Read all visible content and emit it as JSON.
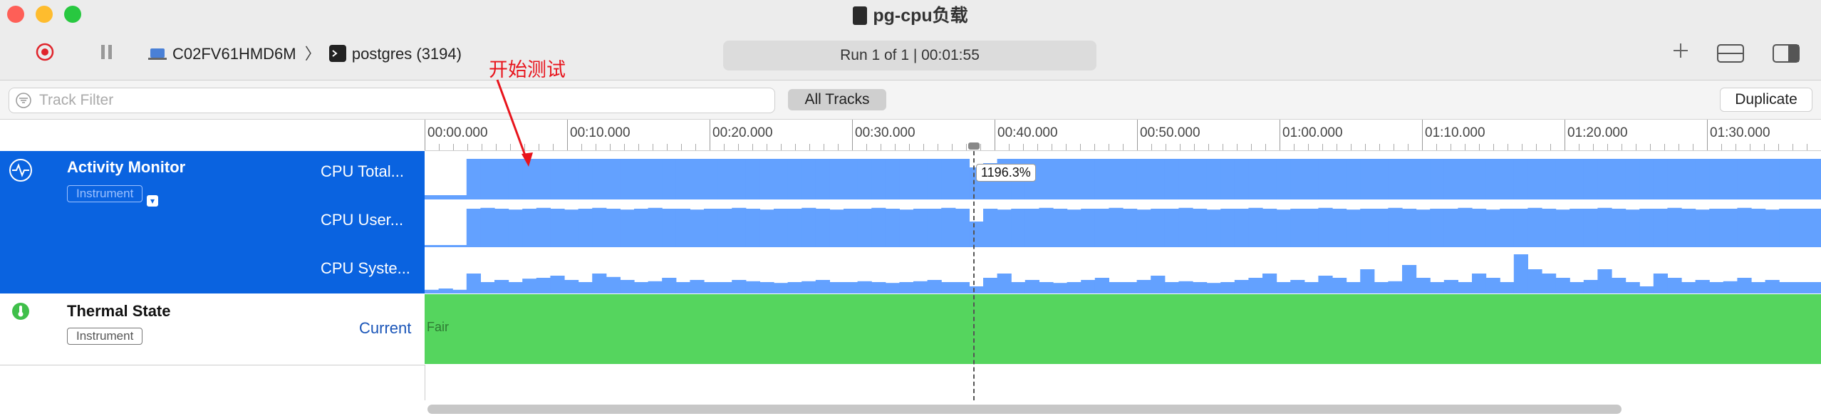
{
  "window": {
    "title": "pg-cpu负载",
    "target_device": "C02FV61HMD6M",
    "target_process": "postgres (3194)",
    "run_status": "Run 1 of 1  |  00:01:55"
  },
  "filterbar": {
    "placeholder": "Track Filter",
    "all_tracks_label": "All Tracks",
    "duplicate_label": "Duplicate"
  },
  "ruler": {
    "labels": [
      "00:00.000",
      "00:10.000",
      "00:20.000",
      "00:30.000",
      "00:40.000",
      "00:50.000",
      "01:00.000",
      "01:10.000",
      "01:20.000",
      "01:30.000"
    ]
  },
  "annotation": {
    "text": "开始测试",
    "color": "#e8141c"
  },
  "tracks": {
    "activity": {
      "name": "Activity Monitor",
      "badge": "Instrument",
      "series": [
        "CPU Total...",
        "CPU User...",
        "CPU Syste..."
      ],
      "tooltip": "1196.3%"
    },
    "thermal": {
      "name": "Thermal State",
      "badge": "Instrument",
      "series_label": "Current",
      "state": "Fair"
    }
  },
  "colors": {
    "selection": "#0a63e0",
    "graph_fill": "#63a1ff",
    "thermal_fair": "#55d55e",
    "record": "#e0242b"
  },
  "chart_data": {
    "type": "area",
    "series": [
      {
        "name": "CPU Total...",
        "values": [
          0.1,
          0.1,
          0.1,
          0.95,
          0.95,
          0.95,
          0.95,
          0.95,
          0.95,
          0.95,
          0.95,
          0.95,
          0.95,
          0.95,
          0.95,
          0.95,
          0.95,
          0.95,
          0.95,
          0.95,
          0.95,
          0.95,
          0.95,
          0.95,
          0.95,
          0.95,
          0.95,
          0.95,
          0.95,
          0.95,
          0.95,
          0.95,
          0.95,
          0.95,
          0.95,
          0.95,
          0.95,
          0.95,
          0.95,
          0.75,
          0.85,
          0.95,
          0.95,
          0.95,
          0.95,
          0.95,
          0.95,
          0.95,
          0.95,
          0.95,
          0.95,
          0.95,
          0.95,
          0.95,
          0.95,
          0.95,
          0.95,
          0.95,
          0.95,
          0.95,
          0.95,
          0.95,
          0.95,
          0.95,
          0.95,
          0.95,
          0.95,
          0.95,
          0.95,
          0.95,
          0.95,
          0.95,
          0.95,
          0.95,
          0.95,
          0.95,
          0.95,
          0.95,
          0.95,
          0.95,
          0.95,
          0.95,
          0.95,
          0.95,
          0.95,
          0.95,
          0.95,
          0.95,
          0.95,
          0.95,
          0.95,
          0.95,
          0.95,
          0.95,
          0.95,
          0.95,
          0.95,
          0.95,
          0.95,
          0.95
        ]
      },
      {
        "name": "CPU User...",
        "values": [
          0.05,
          0.05,
          0.05,
          0.9,
          0.92,
          0.9,
          0.88,
          0.9,
          0.92,
          0.9,
          0.88,
          0.9,
          0.92,
          0.9,
          0.88,
          0.9,
          0.92,
          0.9,
          0.9,
          0.88,
          0.9,
          0.9,
          0.92,
          0.9,
          0.88,
          0.9,
          0.9,
          0.92,
          0.9,
          0.88,
          0.9,
          0.9,
          0.92,
          0.9,
          0.88,
          0.9,
          0.9,
          0.92,
          0.9,
          0.6,
          0.9,
          0.88,
          0.9,
          0.9,
          0.92,
          0.9,
          0.88,
          0.9,
          0.9,
          0.92,
          0.9,
          0.88,
          0.9,
          0.9,
          0.92,
          0.9,
          0.88,
          0.9,
          0.9,
          0.92,
          0.9,
          0.88,
          0.9,
          0.9,
          0.92,
          0.9,
          0.88,
          0.9,
          0.9,
          0.92,
          0.9,
          0.88,
          0.9,
          0.9,
          0.92,
          0.9,
          0.88,
          0.9,
          0.9,
          0.92,
          0.9,
          0.88,
          0.9,
          0.9,
          0.92,
          0.9,
          0.88,
          0.9,
          0.9,
          0.92,
          0.9,
          0.88,
          0.9,
          0.9,
          0.92,
          0.9,
          0.88,
          0.9,
          0.9,
          0.9
        ]
      },
      {
        "name": "CPU Syste...",
        "values": [
          0.12,
          0.15,
          0.12,
          0.5,
          0.3,
          0.35,
          0.3,
          0.38,
          0.4,
          0.45,
          0.35,
          0.3,
          0.5,
          0.42,
          0.35,
          0.3,
          0.32,
          0.4,
          0.3,
          0.35,
          0.3,
          0.3,
          0.35,
          0.32,
          0.3,
          0.28,
          0.3,
          0.32,
          0.35,
          0.3,
          0.3,
          0.32,
          0.3,
          0.28,
          0.3,
          0.32,
          0.35,
          0.3,
          0.3,
          0.2,
          0.4,
          0.5,
          0.3,
          0.35,
          0.3,
          0.28,
          0.3,
          0.35,
          0.4,
          0.3,
          0.3,
          0.35,
          0.45,
          0.3,
          0.32,
          0.3,
          0.28,
          0.3,
          0.35,
          0.4,
          0.5,
          0.3,
          0.35,
          0.3,
          0.45,
          0.4,
          0.3,
          0.6,
          0.3,
          0.32,
          0.7,
          0.4,
          0.3,
          0.35,
          0.3,
          0.5,
          0.4,
          0.3,
          0.95,
          0.6,
          0.5,
          0.4,
          0.3,
          0.35,
          0.6,
          0.4,
          0.3,
          0.2,
          0.5,
          0.4,
          0.3,
          0.35,
          0.3,
          0.32,
          0.4,
          0.3,
          0.35,
          0.3,
          0.3,
          0.3
        ]
      }
    ],
    "x_range": [
      "00:00.000",
      "01:35.000"
    ],
    "grid": false
  }
}
